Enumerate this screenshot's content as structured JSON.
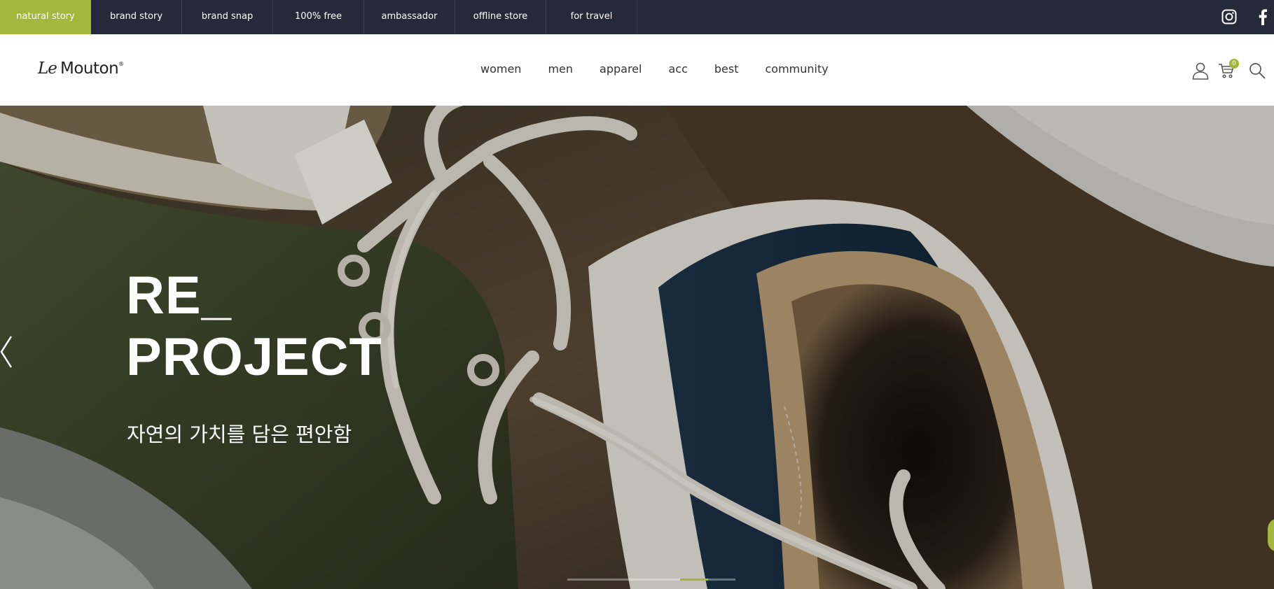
{
  "topbar": {
    "tabs": [
      "natural story",
      "brand story",
      "brand snap",
      "100% free",
      "ambassador",
      "offline store",
      "for travel"
    ],
    "active_tab": "natural story",
    "social": [
      "instagram-icon",
      "facebook-icon"
    ]
  },
  "header": {
    "logo": {
      "le": "Le",
      "mouton": "Mouton",
      "mark": "®"
    },
    "nav": [
      "women",
      "men",
      "apparel",
      "acc",
      "best",
      "community"
    ],
    "icons": [
      "user-icon",
      "cart-icon",
      "search-icon"
    ],
    "cart_count": "0"
  },
  "hero": {
    "title_line1": "RE_",
    "title_line2": "PROJECT",
    "subtitle": "자연의 가치를 담은 편안함",
    "pager_active_index": 5,
    "pager_total": 6
  },
  "colors": {
    "topbar_bg": "#242a3a",
    "accent": "#a2b73c",
    "text": "#333333"
  }
}
